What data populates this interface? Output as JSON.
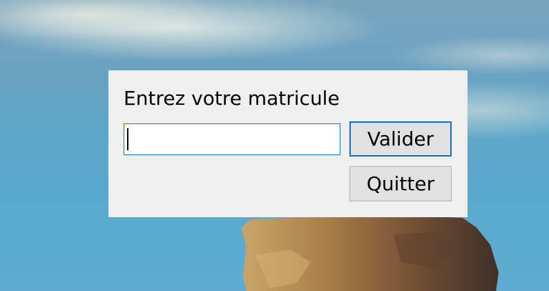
{
  "dialog": {
    "prompt_label": "Entrez votre matricule",
    "id_input": {
      "value": "",
      "placeholder": ""
    },
    "validate_label": "Valider",
    "quit_label": "Quitter"
  },
  "colors": {
    "dialog_bg": "#efefef",
    "focus_border": "#0f6fc6",
    "button_bg": "#e1e1e1",
    "button_border": "#adadad"
  }
}
